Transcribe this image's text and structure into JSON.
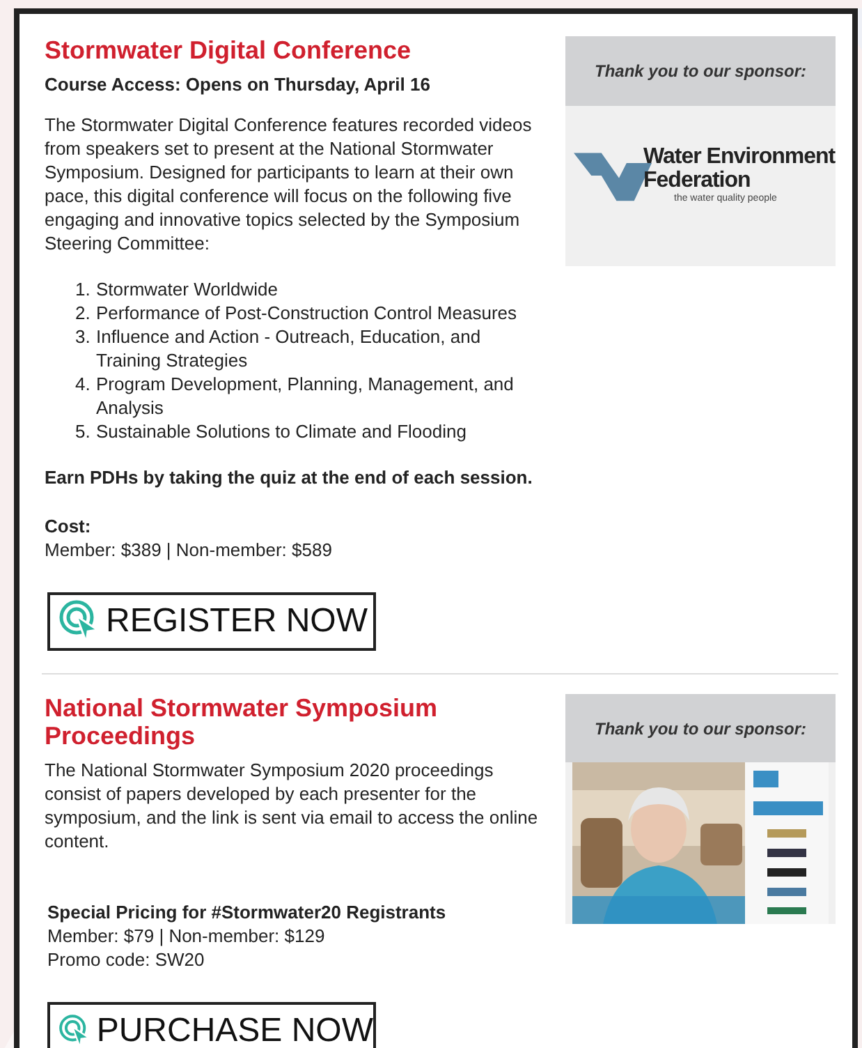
{
  "sections": [
    {
      "title": "Stormwater Digital Conference",
      "blocks": [
        {
          "kind": "subtitle",
          "text": "Course Access: Opens on Thursday, April 16"
        },
        {
          "kind": "paragraph",
          "text": "The Stormwater Digital Conference features recorded videos from speakers set to present at the National Stormwater Symposium. Designed for participants to learn at their own pace, this digital conference will focus on the following five engaging and innovative topics selected by the Symposium Steering Committee:"
        },
        {
          "kind": "list",
          "items": [
            {
              "number": "1.",
              "text": "Stormwater Worldwide"
            },
            {
              "number": "2.",
              "text": "Performance of Post-Construction Control Measures"
            },
            {
              "number": "3.",
              "text": "Influence and Action - Outreach, Education, and Training Strategies"
            },
            {
              "number": "4.",
              "text": "Program Development, Planning, Management, and Analysis"
            },
            {
              "number": "5.",
              "text": "Sustainable Solutions to Climate and Flooding"
            }
          ]
        },
        {
          "kind": "emphasis",
          "text": "Earn PDHs by taking the quiz at the end of each session."
        },
        {
          "kind": "price",
          "label": "Cost:",
          "lines": [
            "Member: $389 | Non-member: $589"
          ]
        }
      ],
      "button": "REGISTER NOW",
      "sponsor": {
        "heading": "Thank you to our sponsor:",
        "kind": "logo",
        "logo": {
          "name": "Water Environment Federation",
          "tagline": "the water quality people"
        }
      }
    },
    {
      "title": "National Stormwater Symposium Proceedings",
      "blocks": [
        {
          "kind": "paragraph",
          "text": "The National Stormwater Symposium 2020 proceedings consist of papers developed by each presenter for the symposium, and the link is sent via email to access the online content."
        },
        {
          "kind": "price",
          "label": "Special Pricing for #Stormwater20 Registrants",
          "lines": [
            "Member: $79 | Non-member: $129",
            "Promo code: SW20"
          ]
        }
      ],
      "button": "PURCHASE NOW",
      "sponsor": {
        "heading": "Thank you to our sponsor:",
        "kind": "picture"
      }
    }
  ]
}
